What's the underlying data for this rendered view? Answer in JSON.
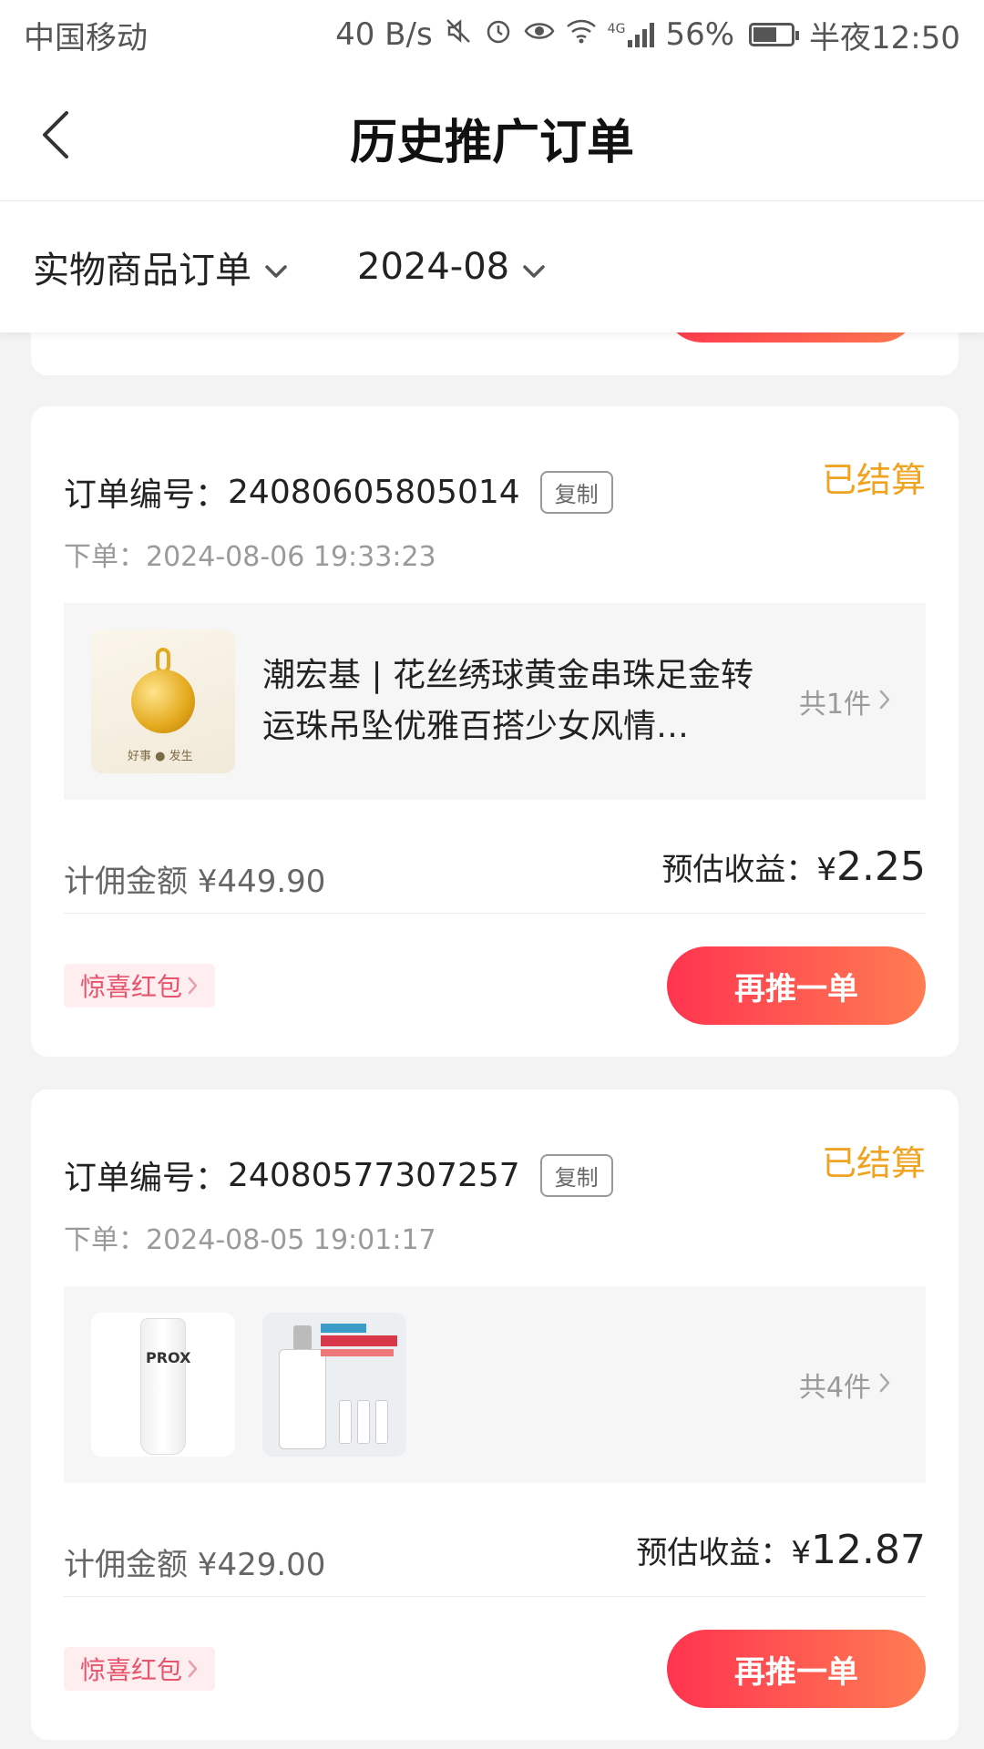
{
  "status_bar": {
    "carrier": "中国移动",
    "speed": "40 B/s",
    "network": "4G",
    "battery": "56%",
    "time": "半夜12:50"
  },
  "header": {
    "title": "历史推广订单"
  },
  "filters": {
    "type": "实物商品订单",
    "month": "2024-08"
  },
  "orders": [
    {
      "order_label": "订单编号：",
      "order_no": "24080605805014",
      "copy_label": "复制",
      "status": "已结算",
      "order_time": "下单：2024-08-06 19:33:23",
      "goods_title": "潮宏基 | 花丝绣球黄金串珠足金转运珠吊坠优雅百搭少女风情…",
      "goods_count": "共1件",
      "commission": "计佣金额 ¥449.90",
      "income_label": "预估收益：",
      "income_currency": "¥",
      "income_value": "2.25",
      "redpack": "惊喜红包",
      "repromote": "再推一单",
      "thumb_caption": "好事 ● 发生"
    },
    {
      "order_label": "订单编号：",
      "order_no": "24080577307257",
      "copy_label": "复制",
      "status": "已结算",
      "order_time": "下单：2024-08-05 19:01:17",
      "goods_count": "共4件",
      "commission": "计佣金额 ¥429.00",
      "income_label": "预估收益：",
      "income_currency": "¥",
      "income_value": "12.87",
      "redpack": "惊喜红包",
      "repromote": "再推一单",
      "thumb_brand": "PROX"
    }
  ],
  "colors": {
    "status": "#f0a320",
    "accent_start": "#ff3450",
    "accent_end": "#ff7c52"
  }
}
